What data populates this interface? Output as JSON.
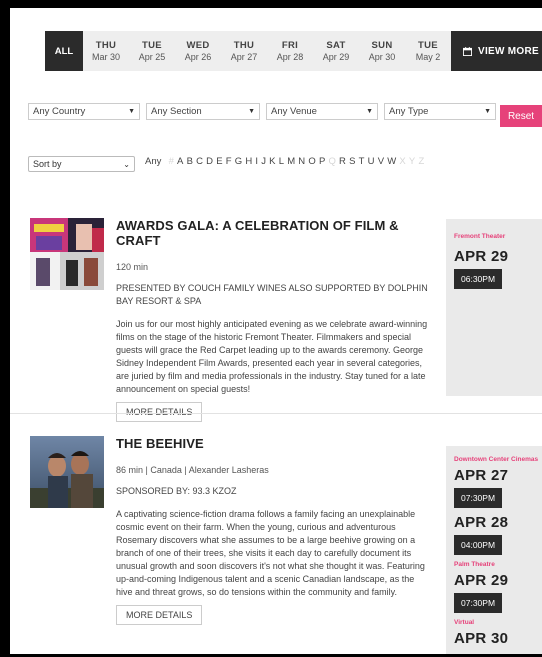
{
  "datebar": {
    "all_label": "ALL",
    "dates": [
      {
        "dow": "THU",
        "md": "Mar 30"
      },
      {
        "dow": "TUE",
        "md": "Apr 25"
      },
      {
        "dow": "WED",
        "md": "Apr 26"
      },
      {
        "dow": "THU",
        "md": "Apr 27"
      },
      {
        "dow": "FRI",
        "md": "Apr 28"
      },
      {
        "dow": "SAT",
        "md": "Apr 29"
      },
      {
        "dow": "SUN",
        "md": "Apr 30"
      },
      {
        "dow": "TUE",
        "md": "May 2"
      }
    ],
    "view_more_label": "VIEW MORE"
  },
  "filters": {
    "country": "Any Country",
    "section": "Any Section",
    "venue": "Any Venue",
    "type": "Any Type",
    "reset_label": "Reset"
  },
  "sort": {
    "label": "Sort by"
  },
  "alpha": {
    "any_label": "Any",
    "letters": [
      {
        "l": "#",
        "dim": true
      },
      {
        "l": "A"
      },
      {
        "l": "B"
      },
      {
        "l": "C"
      },
      {
        "l": "D"
      },
      {
        "l": "E"
      },
      {
        "l": "F"
      },
      {
        "l": "G"
      },
      {
        "l": "H"
      },
      {
        "l": "I"
      },
      {
        "l": "J"
      },
      {
        "l": "K"
      },
      {
        "l": "L"
      },
      {
        "l": "M"
      },
      {
        "l": "N"
      },
      {
        "l": "O"
      },
      {
        "l": "P"
      },
      {
        "l": "Q",
        "dim": true
      },
      {
        "l": "R"
      },
      {
        "l": "S"
      },
      {
        "l": "T"
      },
      {
        "l": "U"
      },
      {
        "l": "V"
      },
      {
        "l": "W"
      },
      {
        "l": "X",
        "dim": true
      },
      {
        "l": "Y",
        "dim": true
      },
      {
        "l": "Z",
        "dim": true
      }
    ]
  },
  "events": [
    {
      "title": "AWARDS GALA: A CELEBRATION OF FILM & CRAFT",
      "meta": "120 min",
      "sponsor": "PRESENTED BY COUCH FAMILY WINES ALSO SUPPORTED BY DOLPHIN BAY RESORT & SPA",
      "desc": "Join us for our most highly anticipated evening as we celebrate award-winning films on the stage of the historic Fremont Theater. Filmmakers and special guests will grace the Red Carpet leading up to the awards ceremony. George Sidney Independent Film Awards, presented each year in several categories, are juried by film and media professionals in the industry. Stay tuned for a late announcement on special guests!",
      "more_label": "MORE DETAILS",
      "screenings": [
        {
          "venue": "Fremont Theater",
          "date": "APR 29",
          "time": "06:30PM"
        }
      ]
    },
    {
      "title": "THE BEEHIVE",
      "meta": "86 min | Canada | Alexander Lasheras",
      "sponsor": "SPONSORED BY: 93.3 KZOZ",
      "desc": "A captivating science-fiction drama follows a family facing an unexplainable cosmic event on their farm. When the young, curious and adventurous Rosemary discovers what she assumes to be a large beehive growing on a branch of one of their trees, she visits it each day to carefully document its unusual growth and soon discovers it's not what she thought it was. Featuring up-and-coming Indigenous talent and a scenic Canadian landscape, as the hive and threat grows, so do tensions within the community and family.",
      "more_label": "MORE DETAILS",
      "screenings": [
        {
          "venue": "Downtown Center Cinemas",
          "date": "APR 27",
          "time": "07:30PM"
        },
        {
          "venue": "",
          "date": "APR 28",
          "time": "04:00PM"
        },
        {
          "venue": "Palm Theatre",
          "date": "APR 29",
          "time": "07:30PM"
        },
        {
          "venue": "Virtual",
          "date": "APR 30",
          "time": ""
        }
      ]
    }
  ],
  "colors": {
    "accent": "#e6427a",
    "dark": "#2b2b2b",
    "sidebar_bg": "#eaeaea"
  }
}
